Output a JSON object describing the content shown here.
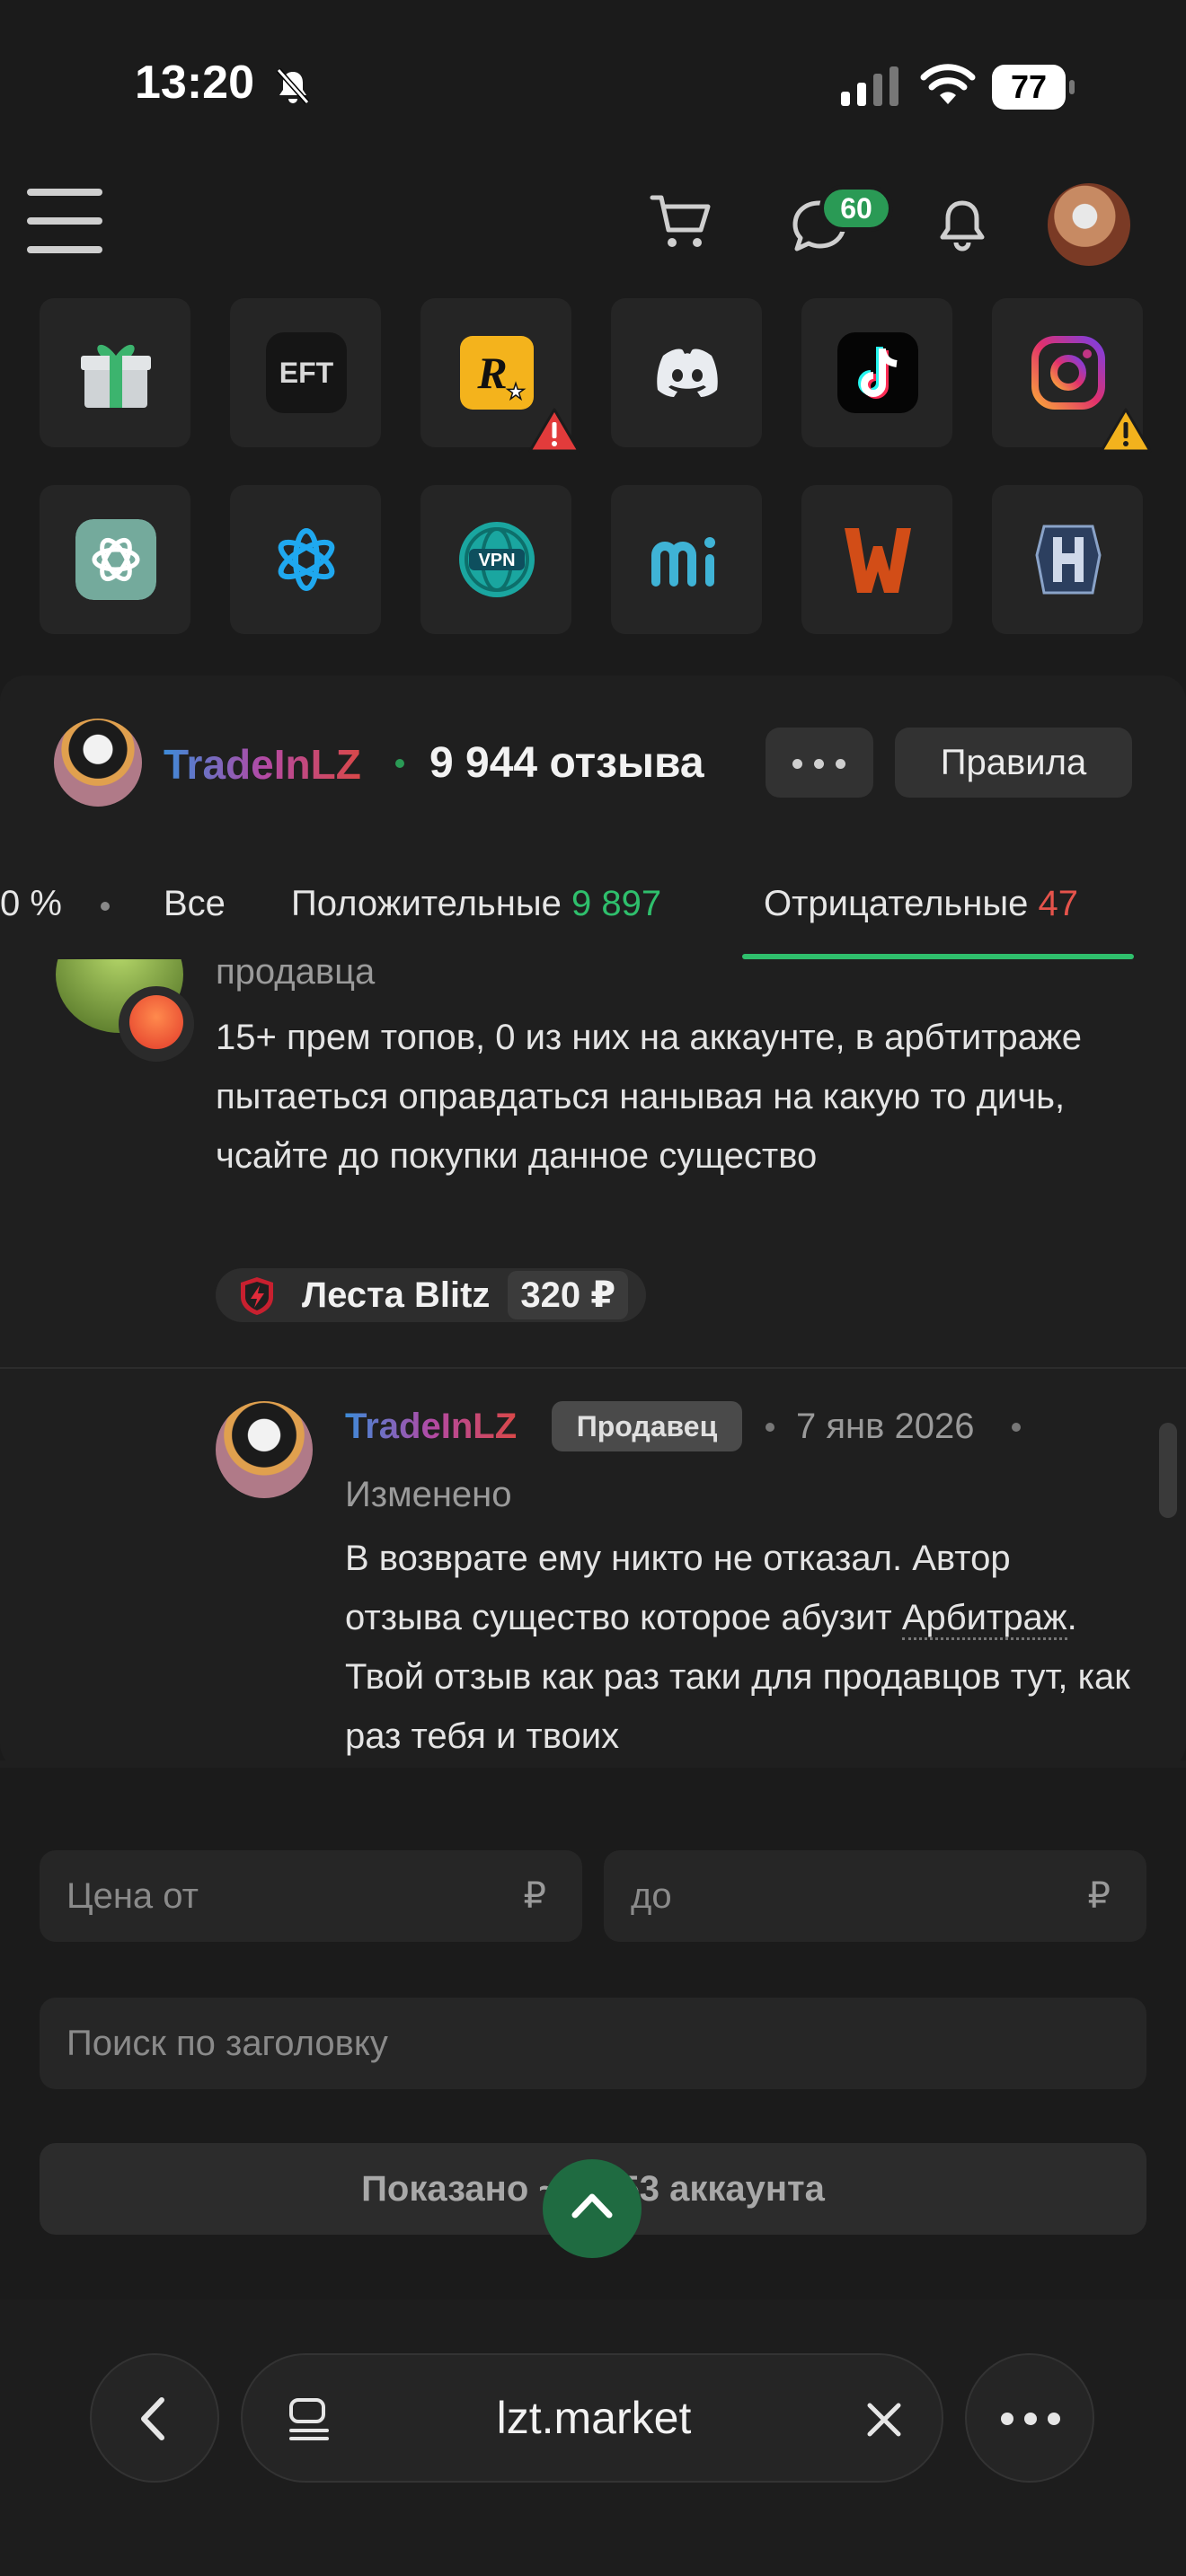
{
  "status": {
    "time": "13:20",
    "battery": "77"
  },
  "header": {
    "chat_badge": "60"
  },
  "icons": {
    "row1": [
      "gift-icon",
      "eft-icon",
      "rockstar-icon",
      "discord-icon",
      "tiktok-icon",
      "instagram-icon"
    ],
    "row2": [
      "chatgpt-icon",
      "battlenet-icon",
      "vpn-icon",
      "miwifi-icon",
      "warface-icon",
      "hypixel-icon"
    ]
  },
  "seller": {
    "name": "TradeInLZ",
    "reviews": "9 944 отзыва",
    "rules_label": "Правила"
  },
  "tabs": {
    "percent": "0 %",
    "all": "Все",
    "positive_label": "Положительные",
    "positive_count": "9 897",
    "negative_label": "Отрицательные",
    "negative_count": "47"
  },
  "review": {
    "label": "продавца",
    "text": "15+ прем топов, 0 из них на аккаунте, в арбтитраже пытаеться оправдаться нанывая на какую то дичь, чсайте до покупки данное существо",
    "tag_name": "Леста Blitz",
    "tag_price": "320 ₽"
  },
  "reply": {
    "name": "TradeInLZ",
    "badge": "Продавец",
    "date": "7 янв 2026",
    "edited": "Изменено",
    "text_before": "В возврате ему никто не отказал. Автор отзыва существо которое абузит ",
    "link": "Арбитраж",
    "text_after": ". Твой отзыв как раз таки для продавцов тут, как раз тебя и твоих"
  },
  "filters": {
    "price_from_placeholder": "Цена от",
    "price_to_placeholder": "до",
    "currency": "₽",
    "search_placeholder": "Поиск по заголовку",
    "shown": "Показано ~ 7 653 аккаунта"
  },
  "browser": {
    "url": "lzt.market"
  }
}
